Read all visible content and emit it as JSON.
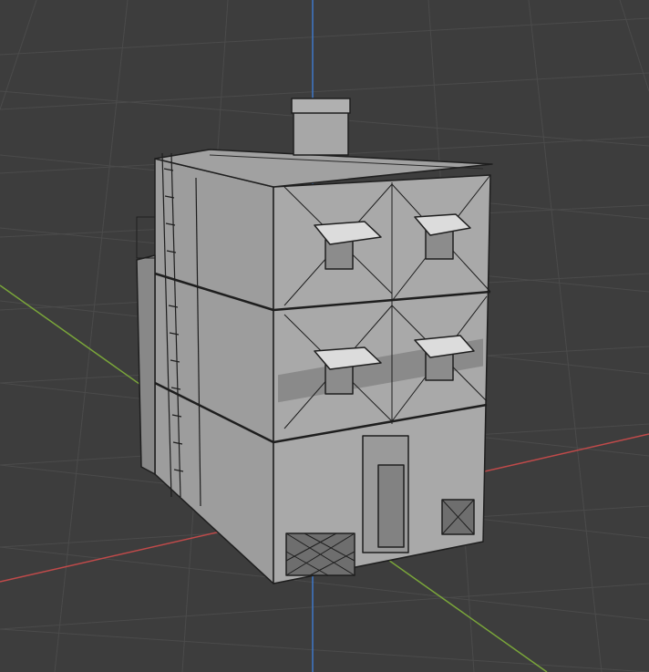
{
  "viewport": {
    "background": "#3d3d3d",
    "grid_color": "#4a4a4a",
    "x_axis_color": "#c04a4a",
    "y_axis_color": "#7aa63a",
    "z_axis_color": "#3f78c8"
  },
  "object": {
    "type": "wireframe-building",
    "stories": 3,
    "face_color": "#a9a9a9",
    "edge_color": "#1e1e1e"
  }
}
